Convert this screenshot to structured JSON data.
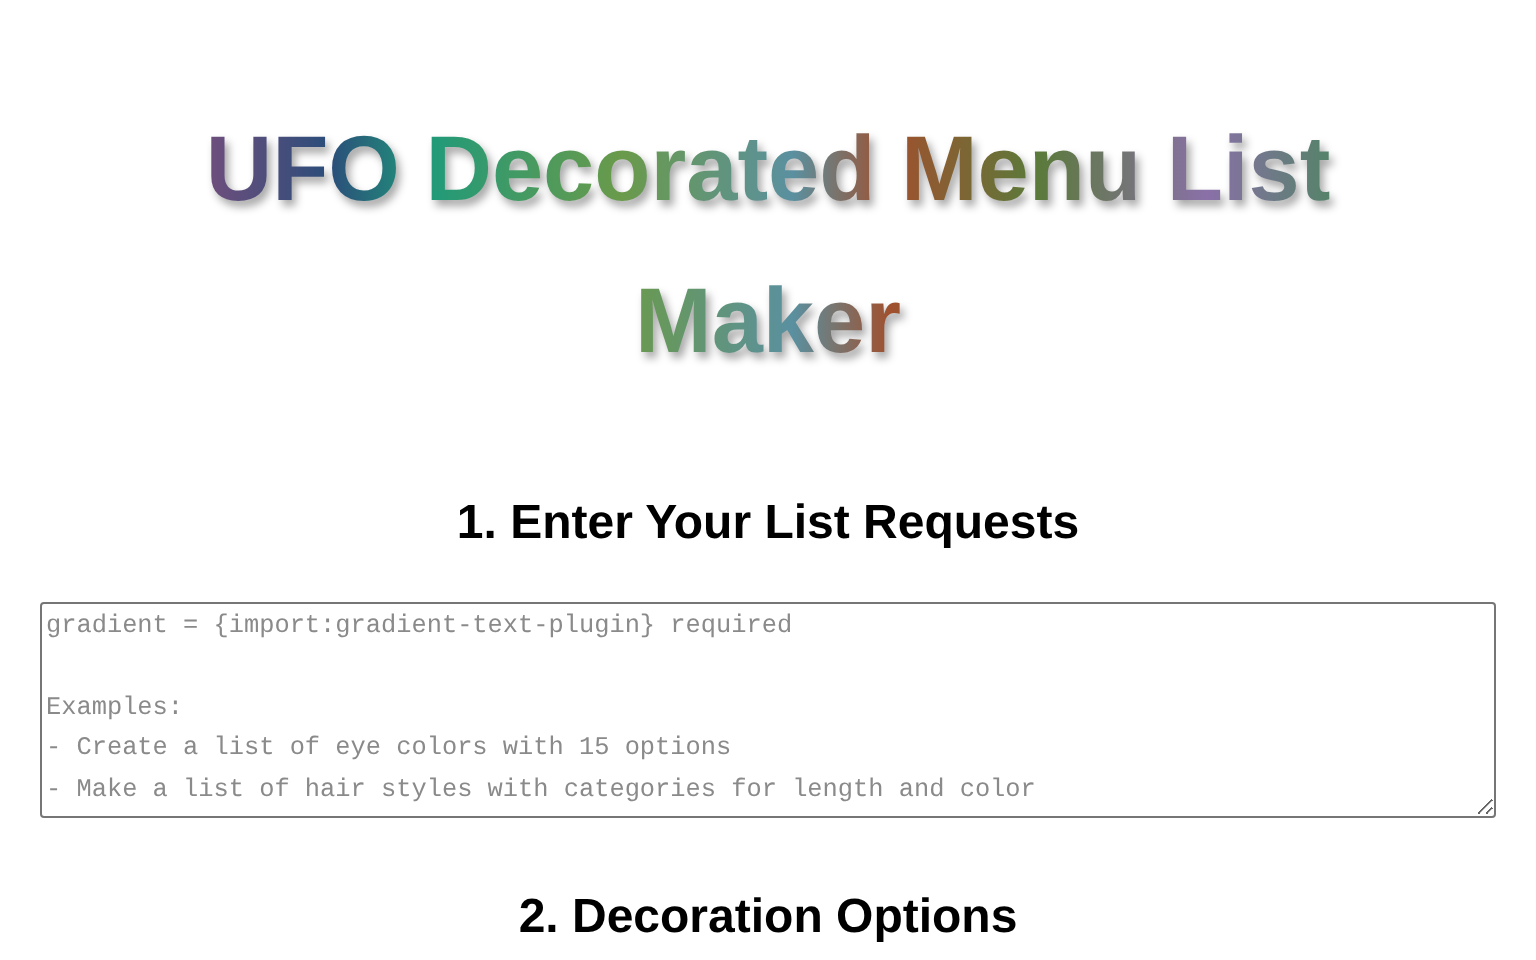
{
  "title": "UFO Decorated Menu List Maker",
  "sections": [
    {
      "heading": "1. Enter Your List Requests",
      "placeholder": "gradient = {import:gradient-text-plugin} required\n\nExamples:\n- Create a list of eye colors with 15 options\n- Make a list of hair styles with categories for length and color"
    },
    {
      "heading": "2. Decoration Options"
    }
  ]
}
